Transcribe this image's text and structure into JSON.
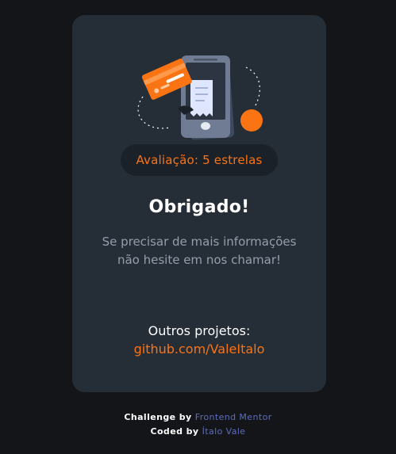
{
  "card": {
    "rating": "Avaliação: 5 estrelas",
    "title": "Obrigado!",
    "message": "Se precisar de mais informações não hesite em nos chamar!",
    "projects_label": "Outros projetos:",
    "projects_link": "github.com/ValeItalo"
  },
  "attribution": {
    "challenge_prefix": "Challenge by",
    "challenge_link": "Frontend Mentor",
    "coded_prefix": "Coded by",
    "coded_link": "Ítalo Vale"
  },
  "colors": {
    "page_background": "#131518",
    "card_background": "#252d37",
    "accent": "#fb7413",
    "muted_text": "#959eac",
    "link": "#5e6cc0"
  },
  "icons": {
    "illustration": "thank-you-illustration"
  }
}
